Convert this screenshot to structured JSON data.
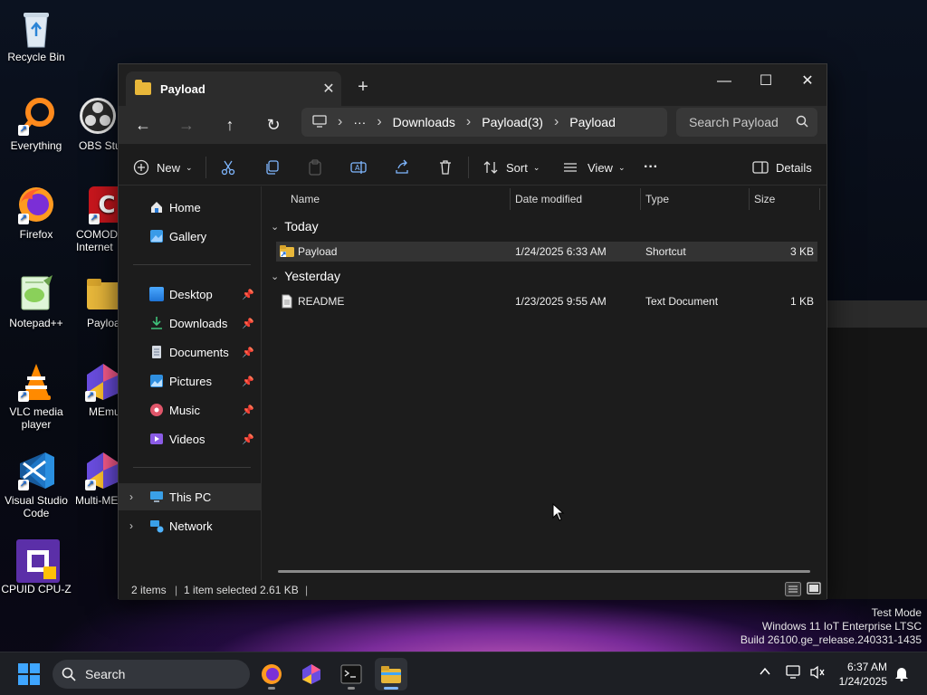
{
  "desktop": {
    "icons": [
      {
        "label": "Recycle Bin"
      },
      {
        "label": "Everything"
      },
      {
        "label": "OBS Stu"
      },
      {
        "label": "Firefox"
      },
      {
        "label": "COMOD Internet"
      },
      {
        "label": "Notepad++"
      },
      {
        "label": "Payloa"
      },
      {
        "label": "VLC media player"
      },
      {
        "label": "MEmu"
      },
      {
        "label": "Visual Studio Code"
      },
      {
        "label": "Multi-ME"
      },
      {
        "label": "CPUID CPU-Z"
      }
    ]
  },
  "explorer": {
    "tab_title": "Payload",
    "tab_close": "✕",
    "new_tab": "+",
    "window_controls": {
      "minimize": "—",
      "maximize": "☐",
      "close": "✕"
    },
    "address": {
      "segments": [
        "Downloads",
        "Payload(3)",
        "Payload"
      ],
      "overflow": "···"
    },
    "search_placeholder": "Search Payload",
    "toolbar": {
      "new": "New",
      "sort": "Sort",
      "view": "View",
      "more": "···",
      "details": "Details"
    },
    "nav": {
      "home": "Home",
      "gallery": "Gallery",
      "desktop": "Desktop",
      "downloads": "Downloads",
      "documents": "Documents",
      "pictures": "Pictures",
      "music": "Music",
      "videos": "Videos",
      "this_pc": "This PC",
      "network": "Network"
    },
    "columns": {
      "name": "Name",
      "date": "Date modified",
      "type": "Type",
      "size": "Size"
    },
    "groups": [
      {
        "label": "Today",
        "files": [
          {
            "name": "Payload",
            "date": "1/24/2025 6:33 AM",
            "type": "Shortcut",
            "size": "3 KB",
            "selected": true
          }
        ]
      },
      {
        "label": "Yesterday",
        "files": [
          {
            "name": "README",
            "date": "1/23/2025 9:55 AM",
            "type": "Text Document",
            "size": "1 KB",
            "selected": false
          }
        ]
      }
    ],
    "status": {
      "items": "2 items",
      "selected": "1 item selected  2.61 KB"
    }
  },
  "watermark": {
    "line1": "Test Mode",
    "line2": "Windows 11 IoT Enterprise LTSC",
    "line3": "Build 26100.ge_release.240331-1435"
  },
  "taskbar": {
    "search_label": "Search",
    "time": "6:37 AM",
    "date": "1/24/2025"
  },
  "colors": {
    "accent": "#7fb7ff",
    "folder": "#e8b73a",
    "window_bg": "#1c1c1c"
  }
}
